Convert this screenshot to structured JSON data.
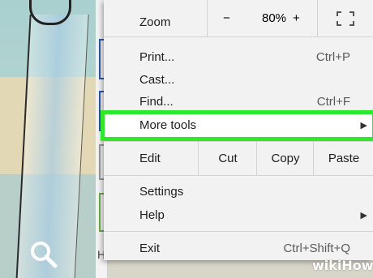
{
  "menu": {
    "zoom": {
      "label": "Zoom",
      "minus": "−",
      "value": "80%",
      "plus": "+"
    },
    "print": {
      "label": "Print...",
      "shortcut": "Ctrl+P"
    },
    "cast": {
      "label": "Cast..."
    },
    "find": {
      "label": "Find...",
      "shortcut": "Ctrl+F"
    },
    "more_tools": {
      "label": "More tools"
    },
    "edit": {
      "label": "Edit",
      "cut": "Cut",
      "copy": "Copy",
      "paste": "Paste"
    },
    "settings": {
      "label": "Settings"
    },
    "help": {
      "label": "Help"
    },
    "exit": {
      "label": "Exit",
      "shortcut": "Ctrl+Shift+Q"
    }
  },
  "page": {
    "partial_letter": "H"
  },
  "watermark": "wikiHow",
  "colors": {
    "highlight": "#2ee82e",
    "menu_bg": "#f2f2f2"
  }
}
